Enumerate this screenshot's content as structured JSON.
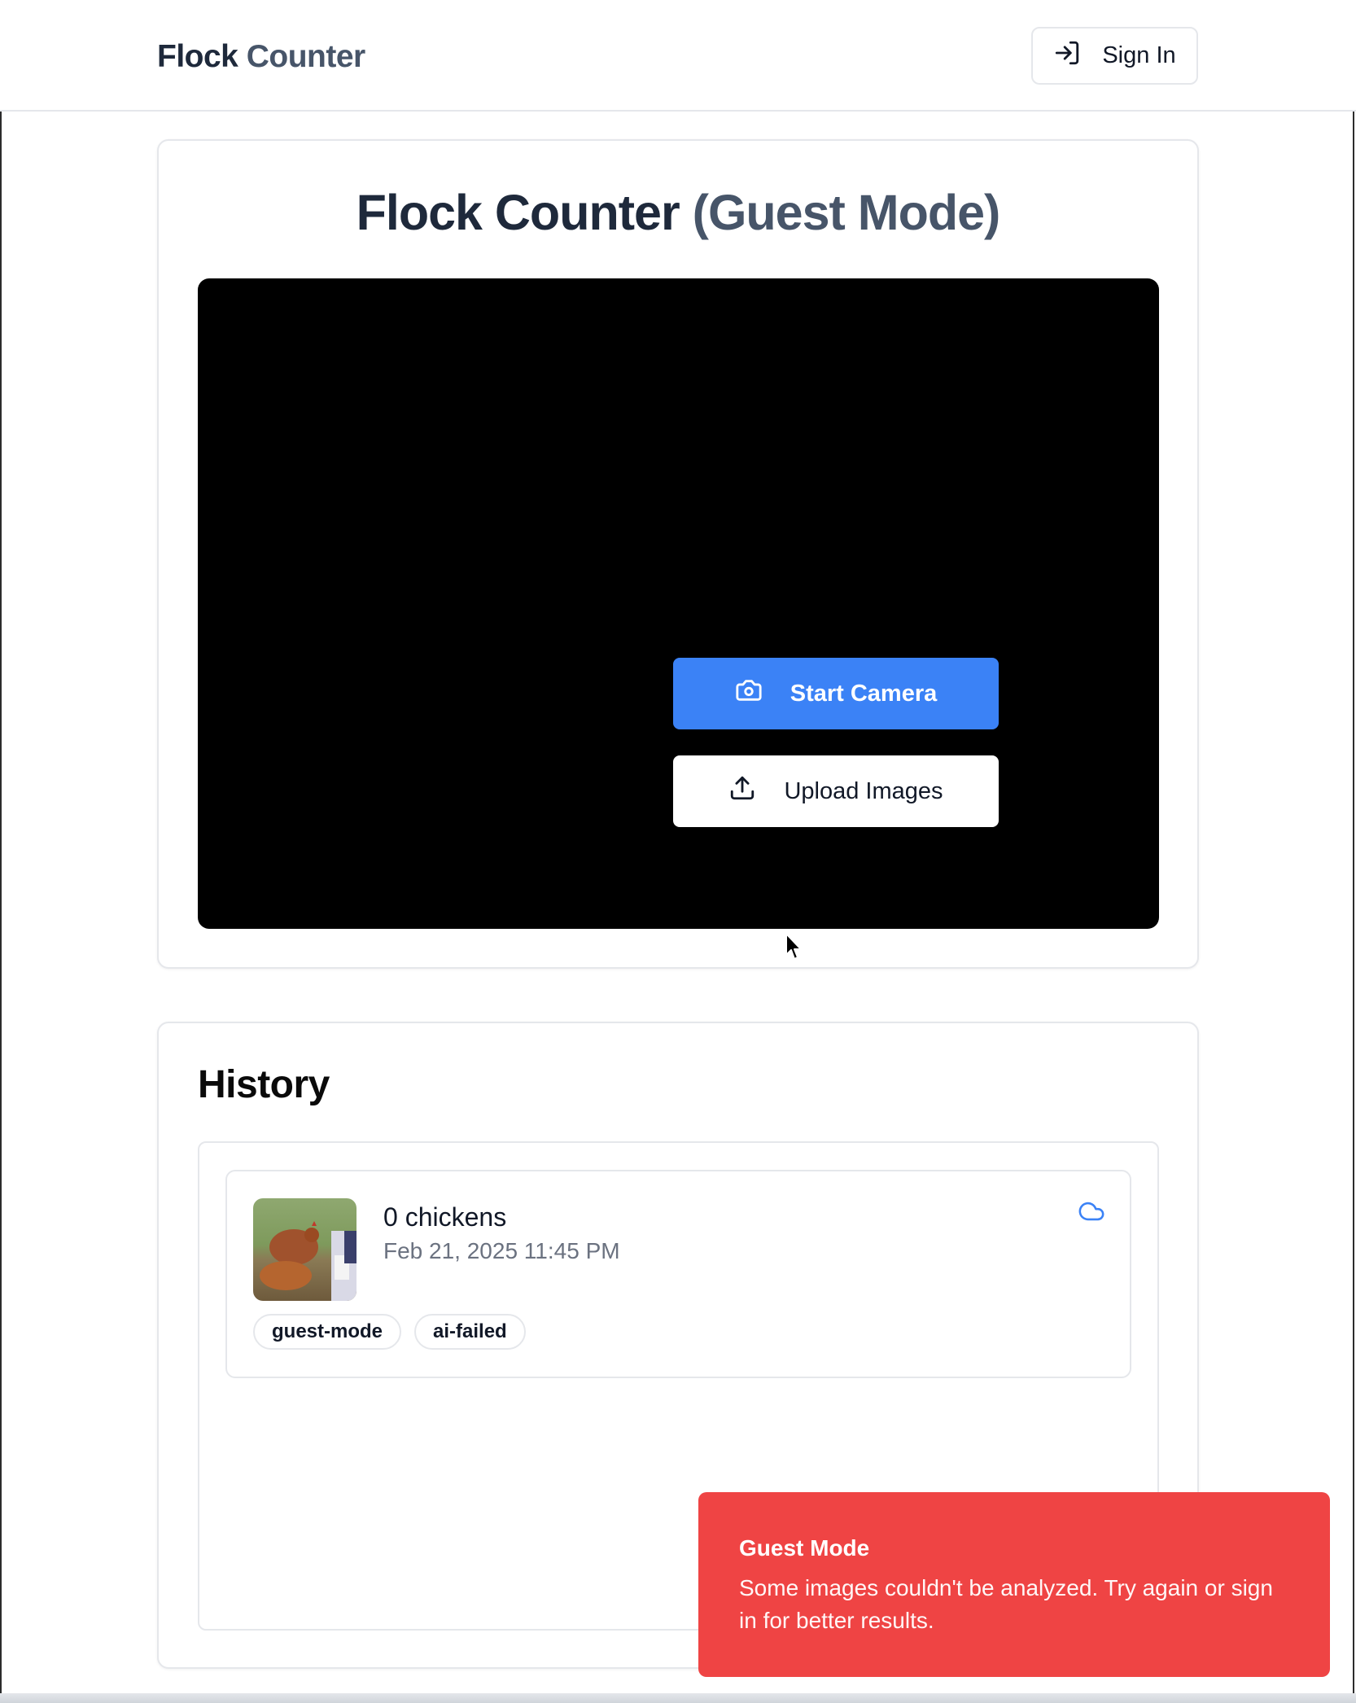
{
  "header": {
    "brand_primary": "Flock",
    "brand_secondary": "Counter",
    "signin_label": "Sign In"
  },
  "main": {
    "title_primary": "Flock Counter",
    "title_secondary": "(Guest Mode)",
    "start_camera_label": "Start Camera",
    "upload_images_label": "Upload Images"
  },
  "history": {
    "title": "History",
    "entries": [
      {
        "count_label": "0 chickens",
        "date": "Feb 21, 2025 11:45 PM",
        "tags": [
          "guest-mode",
          "ai-failed"
        ],
        "sync_icon": "cloud-icon"
      }
    ]
  },
  "toast": {
    "title": "Guest Mode",
    "message": "Some images couldn't be analyzed. Try again or sign in for better results."
  },
  "colors": {
    "primary": "#3b82f6",
    "toast_bg": "#ef4444",
    "camera_bg": "#000000"
  }
}
